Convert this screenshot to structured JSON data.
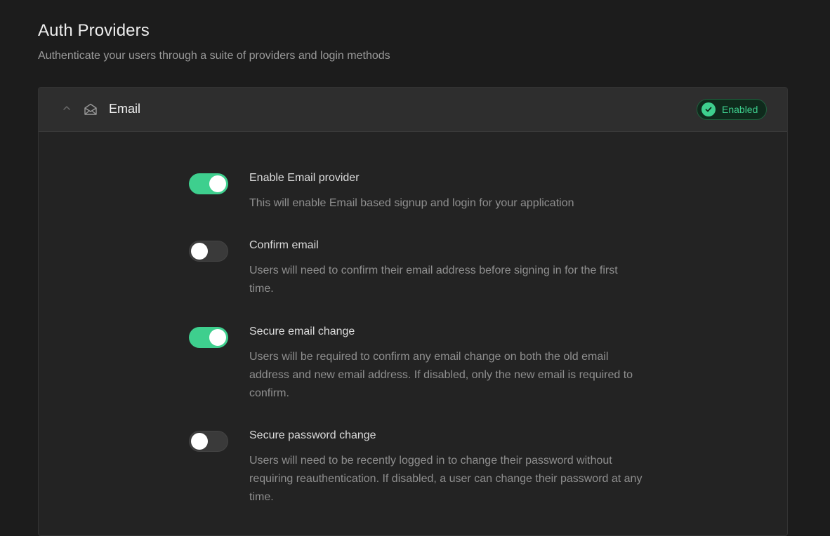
{
  "page": {
    "title": "Auth Providers",
    "subtitle": "Authenticate your users through a suite of providers and login methods"
  },
  "provider": {
    "name": "Email",
    "icon": "mail-icon",
    "expanded": true,
    "status": "Enabled",
    "status_color": "#3ecf8e"
  },
  "settings": [
    {
      "label": "Enable Email provider",
      "description": "This will enable Email based signup and login for your application",
      "enabled": true
    },
    {
      "label": "Confirm email",
      "description": "Users will need to confirm their email address before signing in for the first time.",
      "enabled": false
    },
    {
      "label": "Secure email change",
      "description": "Users will be required to confirm any email change on both the old email address and new email address. If disabled, only the new email is required to confirm.",
      "enabled": true
    },
    {
      "label": "Secure password change",
      "description": "Users will need to be recently logged in to change their password without requiring reauthentication. If disabled, a user can change their password at any time.",
      "enabled": false
    }
  ],
  "colors": {
    "background": "#1c1c1c",
    "accent": "#3ecf8e",
    "toggle_off": "#3a3a3a"
  }
}
